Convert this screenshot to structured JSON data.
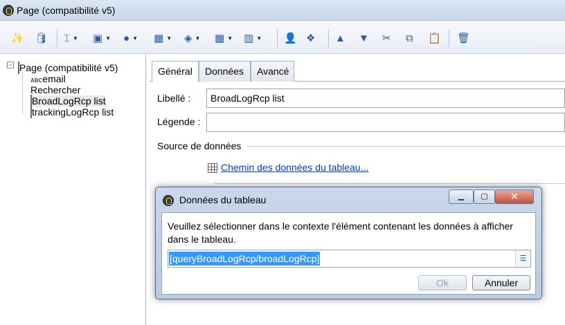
{
  "window": {
    "title": "Page (compatibilité v5)",
    "icon": "adobe-campaign-icon"
  },
  "toolbar": {
    "items": [
      {
        "name": "wand-icon",
        "glyph": "✨",
        "dropdown": false
      },
      {
        "name": "database-icon",
        "glyph": "🛢",
        "dropdown": false
      },
      {
        "name": "text-cursor-icon",
        "glyph": "⌶",
        "dropdown": true
      },
      {
        "name": "form-icon",
        "glyph": "▣",
        "dropdown": true
      },
      {
        "name": "globe-icon",
        "glyph": "●",
        "dropdown": true
      },
      {
        "name": "window-icon",
        "glyph": "▦",
        "dropdown": true
      },
      {
        "name": "layers-icon",
        "glyph": "◈",
        "dropdown": true
      },
      {
        "name": "grid-icon",
        "glyph": "▦",
        "dropdown": true
      },
      {
        "name": "columns-icon",
        "glyph": "▥",
        "dropdown": true
      },
      {
        "name": "user-icon",
        "glyph": "👤",
        "dropdown": false
      },
      {
        "name": "add-shapes-icon",
        "glyph": "❖",
        "dropdown": false
      },
      {
        "name": "arrow-up-icon",
        "glyph": "▲",
        "dropdown": false
      },
      {
        "name": "arrow-down-icon",
        "glyph": "▼",
        "dropdown": false
      },
      {
        "name": "cut-icon",
        "glyph": "✂",
        "dropdown": false
      },
      {
        "name": "copy-icon",
        "glyph": "⧉",
        "dropdown": false
      },
      {
        "name": "paste-icon",
        "glyph": "📋",
        "dropdown": false
      },
      {
        "name": "recycle-bin-icon",
        "glyph": "🗑",
        "dropdown": false
      }
    ]
  },
  "tree": {
    "root": "Page (compatibilité v5)",
    "children": [
      {
        "label": "email",
        "icon": "abc-text-icon"
      },
      {
        "label": "Rechercher",
        "icon": "search-globe-icon"
      },
      {
        "label": "BroadLogRcp list",
        "icon": "table-icon"
      },
      {
        "label": "trackingLogRcp list",
        "icon": "table-icon"
      }
    ]
  },
  "tabs": [
    {
      "label": "Général",
      "active": true
    },
    {
      "label": "Données",
      "active": false
    },
    {
      "label": "Avancé",
      "active": false
    }
  ],
  "form": {
    "libelle_label": "Libellé :",
    "libelle_value": "BroadLogRcp list",
    "legende_label": "Légende :",
    "legende_value": "",
    "source_label": "Source de données",
    "source_link": "Chemin des données du tableau..."
  },
  "dialog": {
    "title": "Données du tableau",
    "minimize": "▁",
    "maximize": "▢",
    "close": "✕",
    "message": "Veuillez sélectionner dans le contexte l'élément contenant les données à afficher dans le tableau.",
    "input_value": "[queryBroadLogRcp/broadLogRcp]",
    "picker_glyph": "☰",
    "ok_label": "Ok",
    "cancel_label": "Annuler"
  }
}
